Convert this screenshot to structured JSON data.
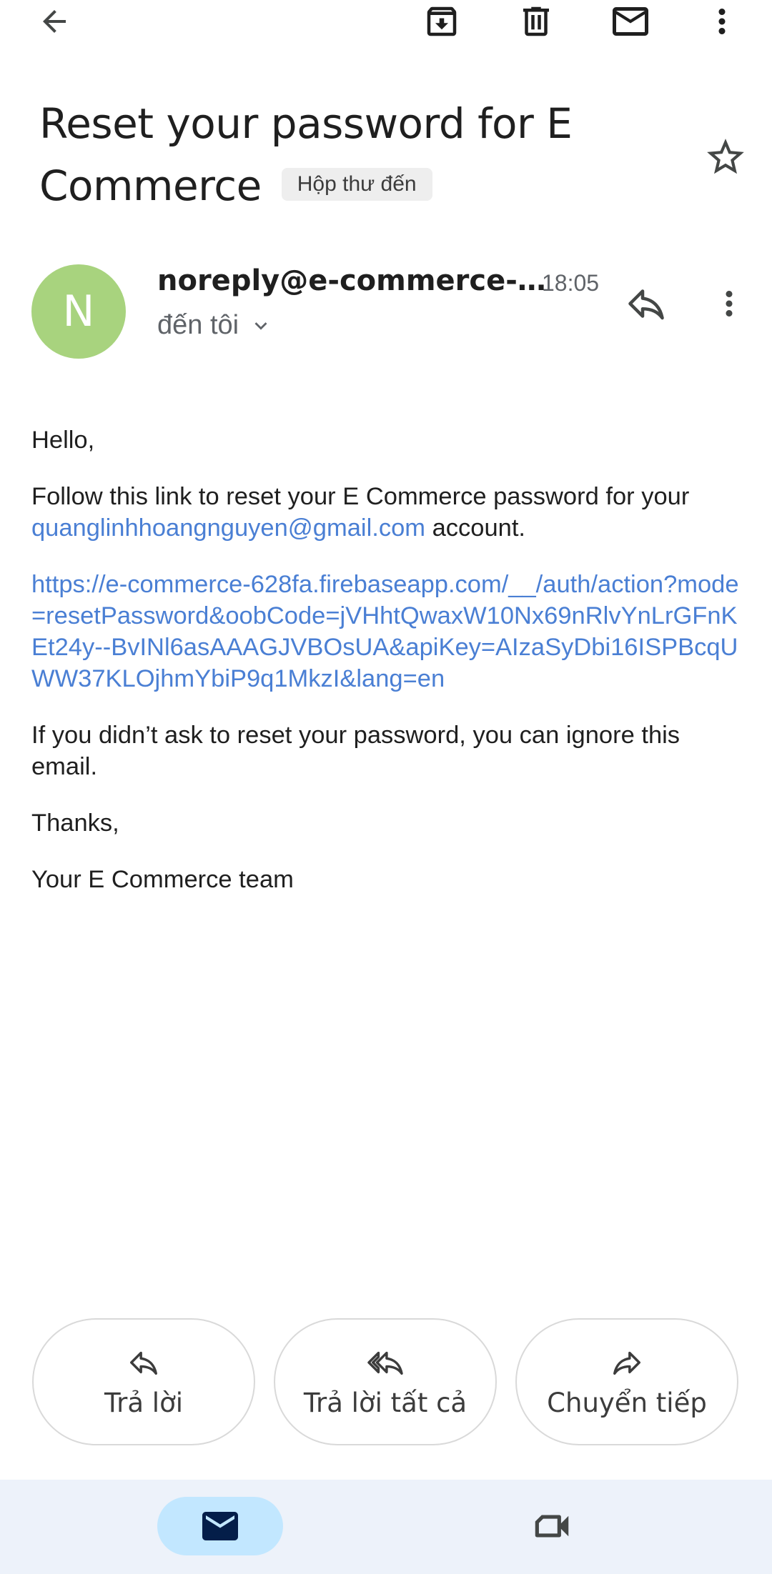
{
  "toolbar": {
    "back": "back-arrow-icon",
    "archive": "archive-icon",
    "delete": "trash-icon",
    "mark_unread": "mail-icon",
    "more": "more-vert-icon"
  },
  "email": {
    "subject": "Reset your password for E Commerce",
    "label": "Hộp thư đến",
    "sender": "noreply@e-commerce-…",
    "time": "18:05",
    "recipient": "đến tôi",
    "avatar_letter": "N",
    "avatar_color": "#a8d37e",
    "body": {
      "greeting": "Hello,",
      "line1_pre": "Follow this link to reset your E Commerce password for your ",
      "email_link": "quanglinhhoangnguyen@gmail.com",
      "line1_post": " account.",
      "reset_link": "https://e-commerce-628fa.firebaseapp.com/__/auth/action?mode=resetPassword&oobCode=jVHhtQwaxW10Nx69nRlvYnLrGFnKEt24y--BvINl6asAAAGJVBOsUA&apiKey=AIzaSyDbi16ISPBcqUWW37KLOjhmYbiP9q1MkzI&lang=en",
      "ignore": "If you didn’t ask to reset your password, you can ignore this email.",
      "thanks": "Thanks,",
      "signature": "Your E Commerce team"
    }
  },
  "actions": {
    "reply": "Trả lời",
    "reply_all": "Trả lời tất cả",
    "forward": "Chuyển tiếp"
  },
  "nav": {
    "mail": "mail-icon",
    "meet": "video-camera-icon"
  },
  "colors": {
    "link": "#4a7fd4",
    "nav_bg": "#edf2fa",
    "nav_active": "#c2e7ff"
  }
}
